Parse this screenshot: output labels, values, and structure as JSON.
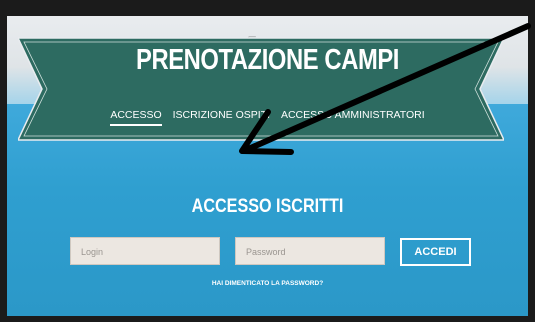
{
  "header": {
    "title": "PRENOTAZIONE CAMPI"
  },
  "nav": {
    "tabs": [
      {
        "label": "ACCESSO",
        "active": true
      },
      {
        "label": "ISCRIZIONE OSPITI",
        "active": false
      },
      {
        "label": "ACCESSO AMMINISTRATORI",
        "active": false
      }
    ]
  },
  "login": {
    "title": "ACCESSO ISCRITTI",
    "username_placeholder": "Login",
    "password_placeholder": "Password",
    "submit_label": "ACCEDI",
    "forgot_label": "HAI DIMENTICATO LA PASSWORD?"
  },
  "colors": {
    "banner": "#2d6b61",
    "sky": "#2f9fd0",
    "button_border": "#ffffff",
    "annotation_arrow": "#000000"
  }
}
